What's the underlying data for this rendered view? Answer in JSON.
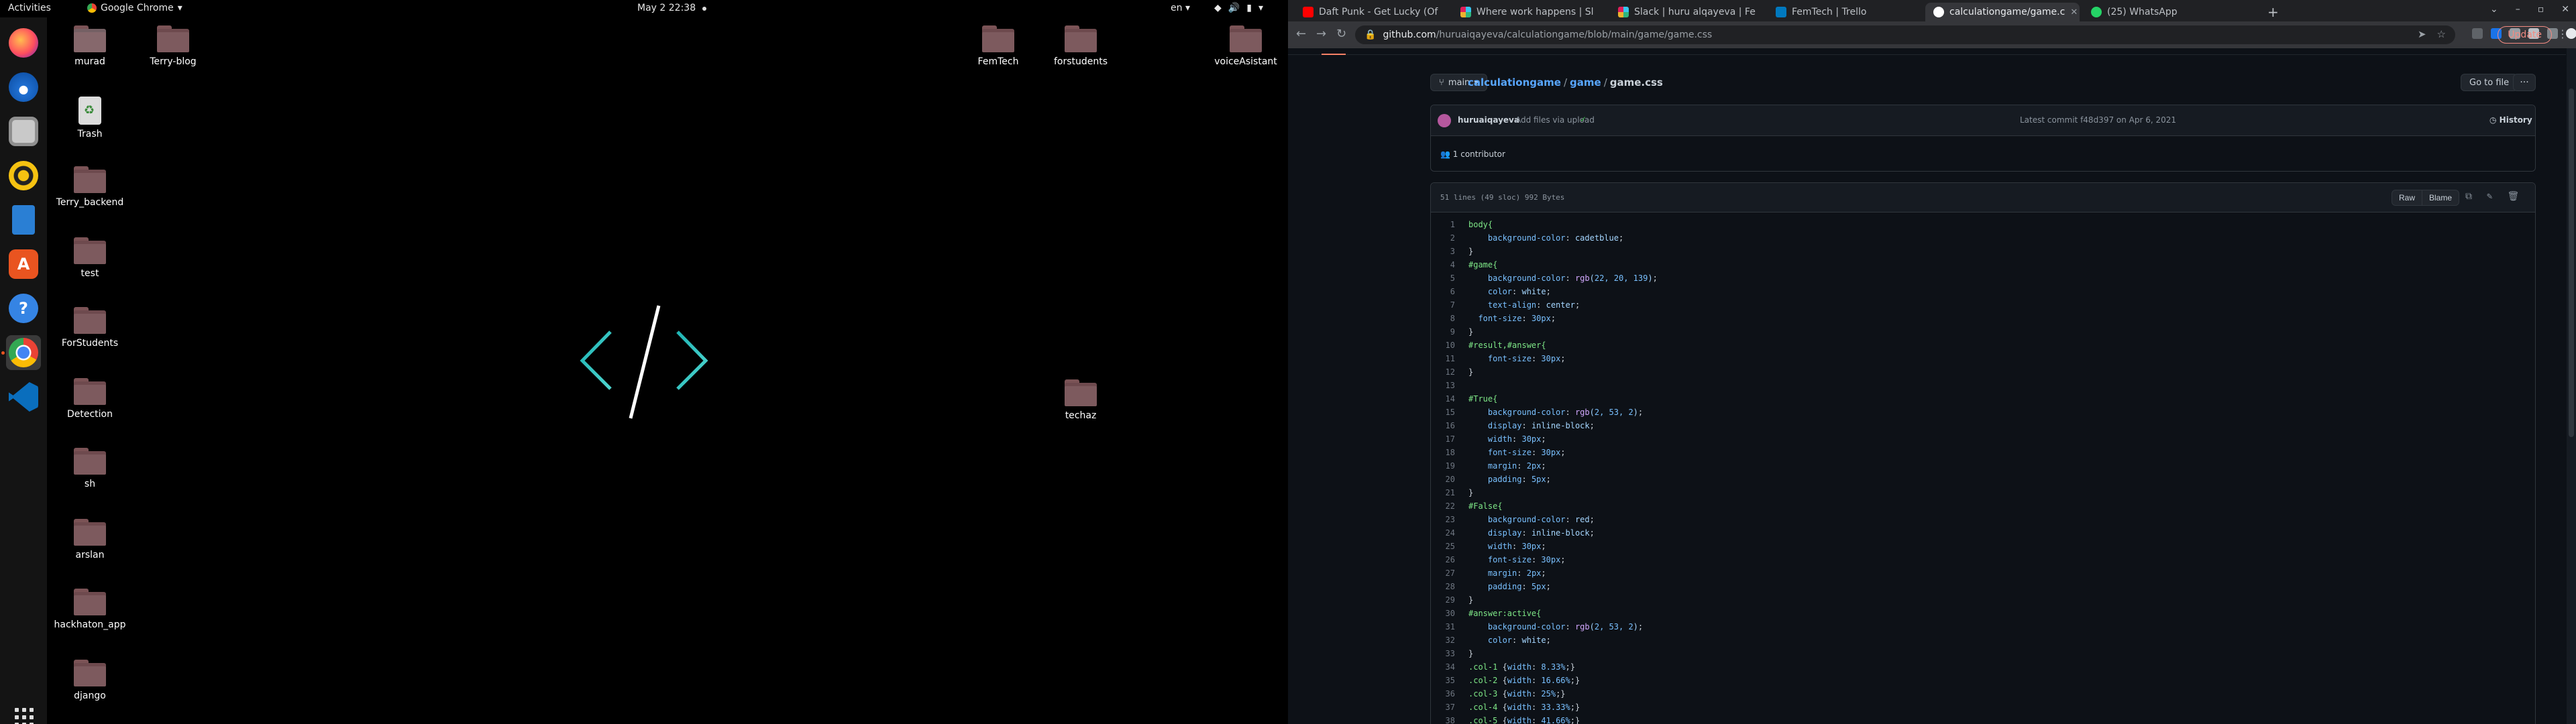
{
  "topbar": {
    "activities": "Activities",
    "app_name": "Google Chrome",
    "clock": "May 2  22:38",
    "lang": "en"
  },
  "dock": {
    "items": [
      "firefox",
      "thunderbird",
      "files",
      "rhythmbox",
      "libreoffice-writer",
      "ubuntu-software",
      "help",
      "google-chrome",
      "vscode"
    ]
  },
  "desktop": {
    "icons": [
      "murad",
      "Terry-blog",
      "Trash",
      "Terry_backend",
      "test",
      "ForStudents",
      "Detection",
      "sh",
      "arslan",
      "hackhaton_app",
      "django",
      "FemTech",
      "forstudents",
      "voiceAsistant",
      "techaz"
    ]
  },
  "browser": {
    "tabs": [
      {
        "title": "Daft Punk - Get Lucky (Of",
        "color": "#ff0000"
      },
      {
        "title": "Where work happens | Sl",
        "color": "#4a154b"
      },
      {
        "title": "Slack | huru alqayeva | Fe",
        "color": "#e01e5a"
      },
      {
        "title": "FemTech | Trello",
        "color": "#0079bf"
      },
      {
        "title": "calculationgame/game.c",
        "color": "#ffffff"
      },
      {
        "title": "(25) WhatsApp",
        "color": "#25d366"
      }
    ],
    "url_host": "github.com",
    "url_path": "/huruaiqayeva/calculationgame/blob/main/game/game.css",
    "update_label": "Update"
  },
  "github": {
    "branch": "main",
    "breadcrumb": {
      "repo": "calculationgame",
      "folder": "game",
      "file": "game.css"
    },
    "goto_file": "Go to file",
    "more": "···",
    "commit": {
      "author": "huruaiqayeva",
      "message": "Add files via upload",
      "latest": "Latest commit f48d397 on Apr 6, 2021",
      "history": "History"
    },
    "contributors": "1 contributor",
    "file_meta": "51 lines (49 sloc)   992 Bytes",
    "raw": "Raw",
    "blame": "Blame",
    "code": [
      "body{",
      "    background-color: cadetblue;",
      "}",
      "#game{",
      "    background-color: rgb(22, 20, 139);",
      "    color: white;",
      "    text-align: center;",
      "  font-size: 30px;",
      "}",
      "#result,#answer{",
      "    font-size: 30px;",
      "}",
      "",
      "#True{",
      "    background-color: rgb(2, 53, 2);",
      "    display: inline-block;",
      "    width: 30px;",
      "    font-size: 30px;",
      "    margin: 2px;",
      "    padding: 5px;",
      "}",
      "#False{",
      "    background-color: red;",
      "    display: inline-block;",
      "    width: 30px;",
      "    font-size: 30px;",
      "    margin: 2px;",
      "    padding: 5px;",
      "}",
      "#answer:active{",
      "    background-color: rgb(2, 53, 2);",
      "    color: white;",
      "}",
      ".col-1 {width: 8.33%;}",
      ".col-2 {width: 16.66%;}",
      ".col-3 {width: 25%;}",
      ".col-4 {width: 33.33%;}",
      ".col-5 {width: 41.66%;}"
    ]
  }
}
